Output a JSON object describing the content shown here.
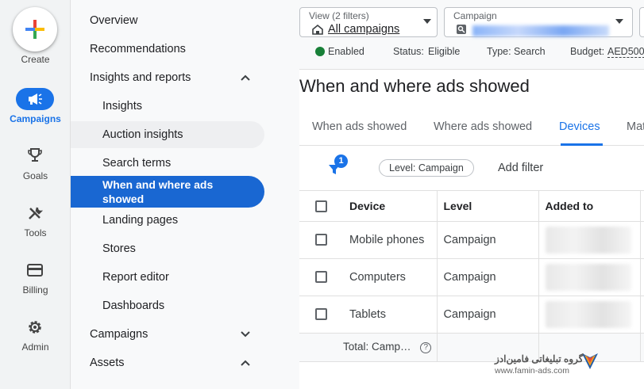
{
  "rail": {
    "create_label": "Create",
    "items": [
      {
        "label": "Campaigns",
        "icon": "megaphone-icon",
        "active": true
      },
      {
        "label": "Goals",
        "icon": "trophy-icon"
      },
      {
        "label": "Tools",
        "icon": "tools-icon"
      },
      {
        "label": "Billing",
        "icon": "credit-card-icon"
      },
      {
        "label": "Admin",
        "icon": "gear-icon"
      }
    ]
  },
  "nav": {
    "overview": "Overview",
    "recommendations": "Recommendations",
    "insights_reports": "Insights and reports",
    "insights": "Insights",
    "auction_insights": "Auction insights",
    "search_terms": "Search terms",
    "when_where": "When and where ads showed",
    "landing_pages": "Landing pages",
    "stores": "Stores",
    "report_editor": "Report editor",
    "dashboards": "Dashboards",
    "campaigns": "Campaigns",
    "assets": "Assets"
  },
  "topbar": {
    "view_label": "View (2 filters)",
    "view_value": "All campaigns",
    "campaign_label": "Campaign"
  },
  "status": {
    "enabled": "Enabled",
    "status_label": "Status:",
    "status_value": "Eligible",
    "type_label": "Type:",
    "type_value": "Search",
    "budget_label": "Budget:",
    "budget_value": "AED500"
  },
  "page_title": "When and where ads showed",
  "tabs": [
    "When ads showed",
    "Where ads showed",
    "Devices",
    "Mat"
  ],
  "filters": {
    "count": "1",
    "chip": "Level: Campaign",
    "add_filter": "Add filter"
  },
  "table": {
    "headers": {
      "device": "Device",
      "level": "Level",
      "added_to": "Added to"
    },
    "rows": [
      {
        "device": "Mobile phones",
        "level": "Campaign"
      },
      {
        "device": "Computers",
        "level": "Campaign"
      },
      {
        "device": "Tablets",
        "level": "Campaign"
      }
    ],
    "total_label": "Total: Camp…",
    "help_glyph": "?"
  },
  "watermark": {
    "line1": "گروه تبلیغاتی فامین‌ادز",
    "line2": "www.famin-ads.com"
  },
  "colors": {
    "accent": "#1a73e8",
    "active_nav": "#1967d2",
    "enabled": "#188038"
  }
}
